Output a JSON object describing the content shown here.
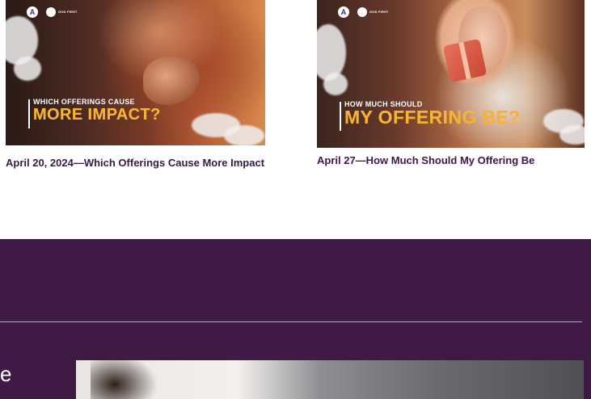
{
  "cards": [
    {
      "thumbnail": {
        "logo_mark": "A",
        "logo_text": "GOD FIRST",
        "headline_small": "WHICH OFFERINGS CAUSE",
        "headline_big": "MORE IMPACT?"
      },
      "caption": "April 20, 2024—Which Offerings Cause More Impact"
    },
    {
      "thumbnail": {
        "logo_mark": "A",
        "logo_text": "GOD FIRST",
        "headline_small": "HOW MUCH SHOULD",
        "headline_big": "MY OFFERING BE?"
      },
      "caption": "April 27—How Much Should My Offering Be"
    }
  ],
  "band": {
    "partial_text": "e",
    "background_color": "#3e1a44"
  },
  "colors": {
    "caption_text": "#3a1848",
    "headline_gold": "#f6b332"
  }
}
